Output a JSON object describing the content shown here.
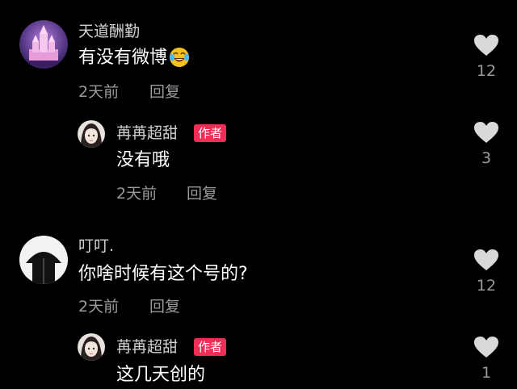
{
  "comments": [
    {
      "username": "天道酬勤",
      "text": "有没有微博",
      "emoji": "laughing-tears-emoji",
      "time": "2天前",
      "reply_label": "回复",
      "likes": "12",
      "replies": [
        {
          "username": "苒苒超甜",
          "badge": "作者",
          "text": "没有哦",
          "time": "2天前",
          "reply_label": "回复",
          "likes": "3"
        }
      ]
    },
    {
      "username": "叮叮.",
      "text": "你啥时候有这个号的?",
      "time": "2天前",
      "reply_label": "回复",
      "likes": "12",
      "replies": [
        {
          "username": "苒苒超甜",
          "badge": "作者",
          "text": "这几天创的",
          "likes": "1"
        }
      ]
    }
  ],
  "icons": {
    "like": "heart-icon"
  },
  "colors": {
    "background": "#000000",
    "badge": "#ef2d55",
    "heart": "#d9d9d9",
    "meta": "#9a9a9a"
  }
}
